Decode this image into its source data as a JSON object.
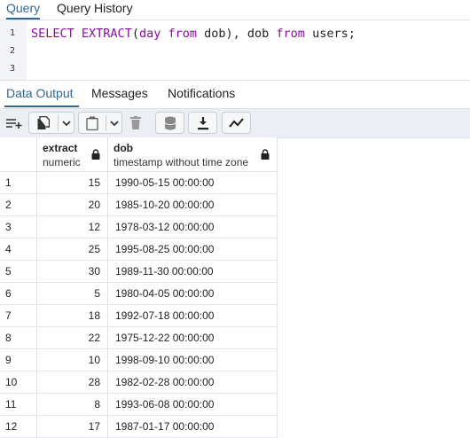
{
  "query_tabs": [
    "Query",
    "Query History"
  ],
  "editor": {
    "line_numbers": [
      "1",
      "2",
      "3"
    ],
    "code": {
      "t1": "SELECT",
      "t2": " ",
      "t3": "EXTRACT",
      "t4": "(",
      "t5": "day",
      "t6": " ",
      "t7": "from",
      "t8": " dob), dob ",
      "t9": "from",
      "t10": " users;"
    }
  },
  "output_tabs": [
    "Data Output",
    "Messages",
    "Notifications"
  ],
  "toolbar": {
    "icons": [
      "add-row-icon",
      "copy-icon",
      "dropdown-icon",
      "paste-icon",
      "dropdown-icon",
      "delete-icon",
      "save-data-icon",
      "download-icon",
      "graph-icon"
    ]
  },
  "grid": {
    "columns": [
      {
        "name": "extract",
        "type": "numeric"
      },
      {
        "name": "dob",
        "type": "timestamp without time zone"
      }
    ],
    "rows": [
      {
        "idx": "1",
        "extract": "15",
        "dob": "1990-05-15 00:00:00"
      },
      {
        "idx": "2",
        "extract": "20",
        "dob": "1985-10-20 00:00:00"
      },
      {
        "idx": "3",
        "extract": "12",
        "dob": "1978-03-12 00:00:00"
      },
      {
        "idx": "4",
        "extract": "25",
        "dob": "1995-08-25 00:00:00"
      },
      {
        "idx": "5",
        "extract": "30",
        "dob": "1989-11-30 00:00:00"
      },
      {
        "idx": "6",
        "extract": "5",
        "dob": "1980-04-05 00:00:00"
      },
      {
        "idx": "7",
        "extract": "18",
        "dob": "1992-07-18 00:00:00"
      },
      {
        "idx": "8",
        "extract": "22",
        "dob": "1975-12-22 00:00:00"
      },
      {
        "idx": "9",
        "extract": "10",
        "dob": "1998-09-10 00:00:00"
      },
      {
        "idx": "10",
        "extract": "28",
        "dob": "1982-02-28 00:00:00"
      },
      {
        "idx": "11",
        "extract": "8",
        "dob": "1993-06-08 00:00:00"
      },
      {
        "idx": "12",
        "extract": "17",
        "dob": "1987-01-17 00:00:00"
      }
    ]
  },
  "colors": {
    "accent": "#326690",
    "keyword": "#8b0ca0",
    "toolbar_bg": "#ebeef3"
  }
}
